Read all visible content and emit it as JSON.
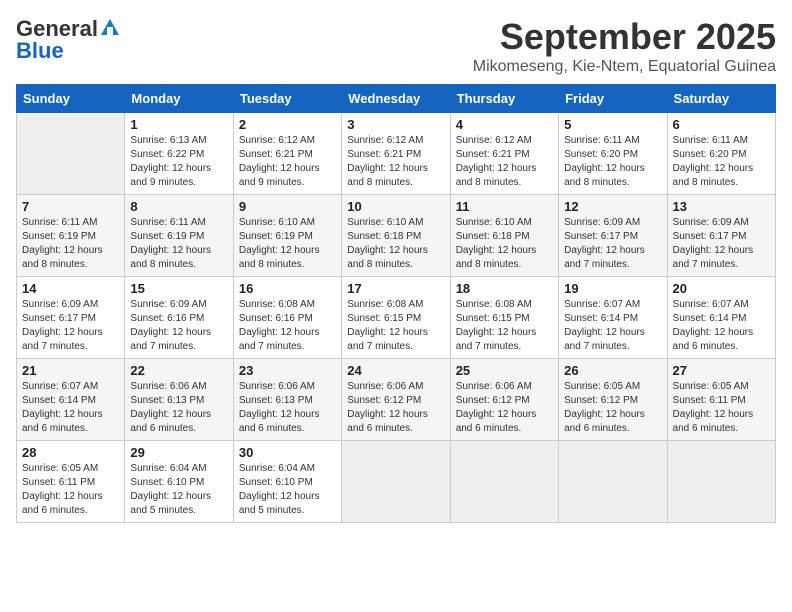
{
  "logo": {
    "line1": "General",
    "line2": "Blue"
  },
  "title": "September 2025",
  "subtitle": "Mikomeseng, Kie-Ntem, Equatorial Guinea",
  "days_of_week": [
    "Sunday",
    "Monday",
    "Tuesday",
    "Wednesday",
    "Thursday",
    "Friday",
    "Saturday"
  ],
  "weeks": [
    [
      {
        "num": "",
        "info": ""
      },
      {
        "num": "1",
        "info": "Sunrise: 6:13 AM\nSunset: 6:22 PM\nDaylight: 12 hours\nand 9 minutes."
      },
      {
        "num": "2",
        "info": "Sunrise: 6:12 AM\nSunset: 6:21 PM\nDaylight: 12 hours\nand 9 minutes."
      },
      {
        "num": "3",
        "info": "Sunrise: 6:12 AM\nSunset: 6:21 PM\nDaylight: 12 hours\nand 8 minutes."
      },
      {
        "num": "4",
        "info": "Sunrise: 6:12 AM\nSunset: 6:21 PM\nDaylight: 12 hours\nand 8 minutes."
      },
      {
        "num": "5",
        "info": "Sunrise: 6:11 AM\nSunset: 6:20 PM\nDaylight: 12 hours\nand 8 minutes."
      },
      {
        "num": "6",
        "info": "Sunrise: 6:11 AM\nSunset: 6:20 PM\nDaylight: 12 hours\nand 8 minutes."
      }
    ],
    [
      {
        "num": "7",
        "info": "Sunrise: 6:11 AM\nSunset: 6:19 PM\nDaylight: 12 hours\nand 8 minutes."
      },
      {
        "num": "8",
        "info": "Sunrise: 6:11 AM\nSunset: 6:19 PM\nDaylight: 12 hours\nand 8 minutes."
      },
      {
        "num": "9",
        "info": "Sunrise: 6:10 AM\nSunset: 6:19 PM\nDaylight: 12 hours\nand 8 minutes."
      },
      {
        "num": "10",
        "info": "Sunrise: 6:10 AM\nSunset: 6:18 PM\nDaylight: 12 hours\nand 8 minutes."
      },
      {
        "num": "11",
        "info": "Sunrise: 6:10 AM\nSunset: 6:18 PM\nDaylight: 12 hours\nand 8 minutes."
      },
      {
        "num": "12",
        "info": "Sunrise: 6:09 AM\nSunset: 6:17 PM\nDaylight: 12 hours\nand 7 minutes."
      },
      {
        "num": "13",
        "info": "Sunrise: 6:09 AM\nSunset: 6:17 PM\nDaylight: 12 hours\nand 7 minutes."
      }
    ],
    [
      {
        "num": "14",
        "info": "Sunrise: 6:09 AM\nSunset: 6:17 PM\nDaylight: 12 hours\nand 7 minutes."
      },
      {
        "num": "15",
        "info": "Sunrise: 6:09 AM\nSunset: 6:16 PM\nDaylight: 12 hours\nand 7 minutes."
      },
      {
        "num": "16",
        "info": "Sunrise: 6:08 AM\nSunset: 6:16 PM\nDaylight: 12 hours\nand 7 minutes."
      },
      {
        "num": "17",
        "info": "Sunrise: 6:08 AM\nSunset: 6:15 PM\nDaylight: 12 hours\nand 7 minutes."
      },
      {
        "num": "18",
        "info": "Sunrise: 6:08 AM\nSunset: 6:15 PM\nDaylight: 12 hours\nand 7 minutes."
      },
      {
        "num": "19",
        "info": "Sunrise: 6:07 AM\nSunset: 6:14 PM\nDaylight: 12 hours\nand 7 minutes."
      },
      {
        "num": "20",
        "info": "Sunrise: 6:07 AM\nSunset: 6:14 PM\nDaylight: 12 hours\nand 6 minutes."
      }
    ],
    [
      {
        "num": "21",
        "info": "Sunrise: 6:07 AM\nSunset: 6:14 PM\nDaylight: 12 hours\nand 6 minutes."
      },
      {
        "num": "22",
        "info": "Sunrise: 6:06 AM\nSunset: 6:13 PM\nDaylight: 12 hours\nand 6 minutes."
      },
      {
        "num": "23",
        "info": "Sunrise: 6:06 AM\nSunset: 6:13 PM\nDaylight: 12 hours\nand 6 minutes."
      },
      {
        "num": "24",
        "info": "Sunrise: 6:06 AM\nSunset: 6:12 PM\nDaylight: 12 hours\nand 6 minutes."
      },
      {
        "num": "25",
        "info": "Sunrise: 6:06 AM\nSunset: 6:12 PM\nDaylight: 12 hours\nand 6 minutes."
      },
      {
        "num": "26",
        "info": "Sunrise: 6:05 AM\nSunset: 6:12 PM\nDaylight: 12 hours\nand 6 minutes."
      },
      {
        "num": "27",
        "info": "Sunrise: 6:05 AM\nSunset: 6:11 PM\nDaylight: 12 hours\nand 6 minutes."
      }
    ],
    [
      {
        "num": "28",
        "info": "Sunrise: 6:05 AM\nSunset: 6:11 PM\nDaylight: 12 hours\nand 6 minutes."
      },
      {
        "num": "29",
        "info": "Sunrise: 6:04 AM\nSunset: 6:10 PM\nDaylight: 12 hours\nand 5 minutes."
      },
      {
        "num": "30",
        "info": "Sunrise: 6:04 AM\nSunset: 6:10 PM\nDaylight: 12 hours\nand 5 minutes."
      },
      {
        "num": "",
        "info": ""
      },
      {
        "num": "",
        "info": ""
      },
      {
        "num": "",
        "info": ""
      },
      {
        "num": "",
        "info": ""
      }
    ]
  ]
}
